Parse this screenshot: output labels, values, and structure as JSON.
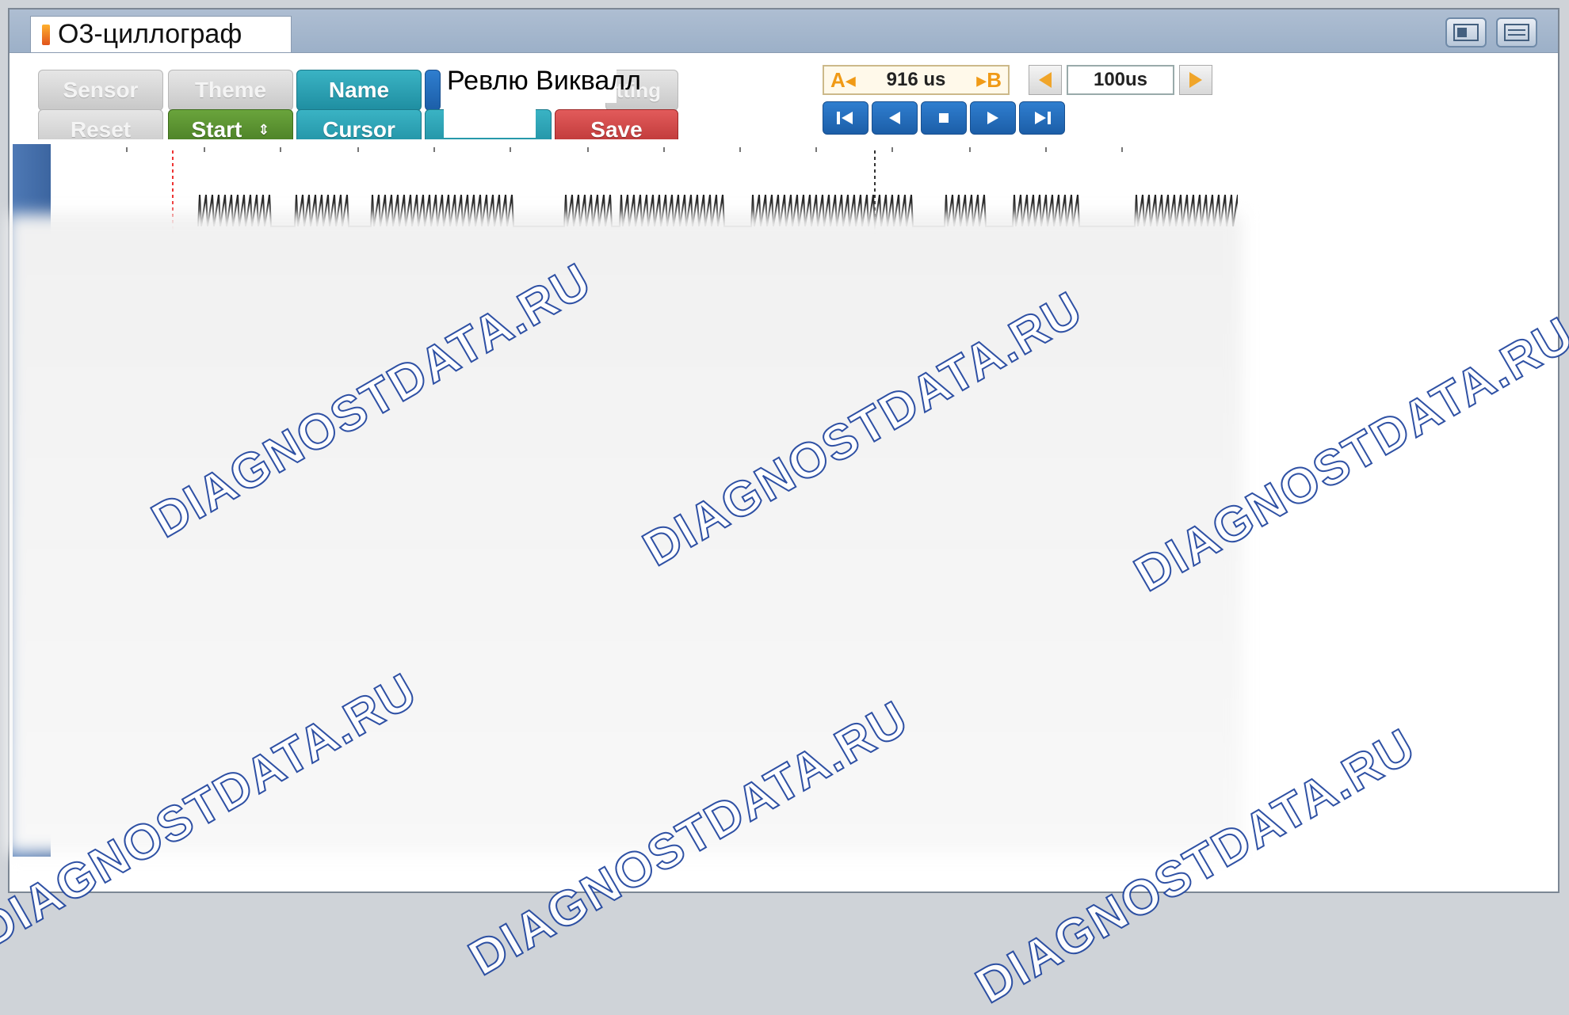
{
  "window": {
    "title": "O3-циллограф"
  },
  "toolbar": {
    "sensor": "Sensor",
    "theme": "Theme",
    "name": "Name",
    "setting": "Setting",
    "reset": "Reset",
    "start": "Start",
    "cursor": "Cursor",
    "save": "Save",
    "tooltip": "Ревлю Виквалл"
  },
  "cursor_panel": {
    "a_label": "A",
    "b_label": "B",
    "delta": "916 us"
  },
  "timebase": {
    "value": "100us"
  },
  "watermark": {
    "text": "DIAGNOSTDATA.RU"
  },
  "colors": {
    "teal": "#2aa2b4",
    "green": "#55902f",
    "red": "#cc4545",
    "blue": "#2570bf",
    "marker_a": "#e33",
    "marker_b": "#333"
  }
}
